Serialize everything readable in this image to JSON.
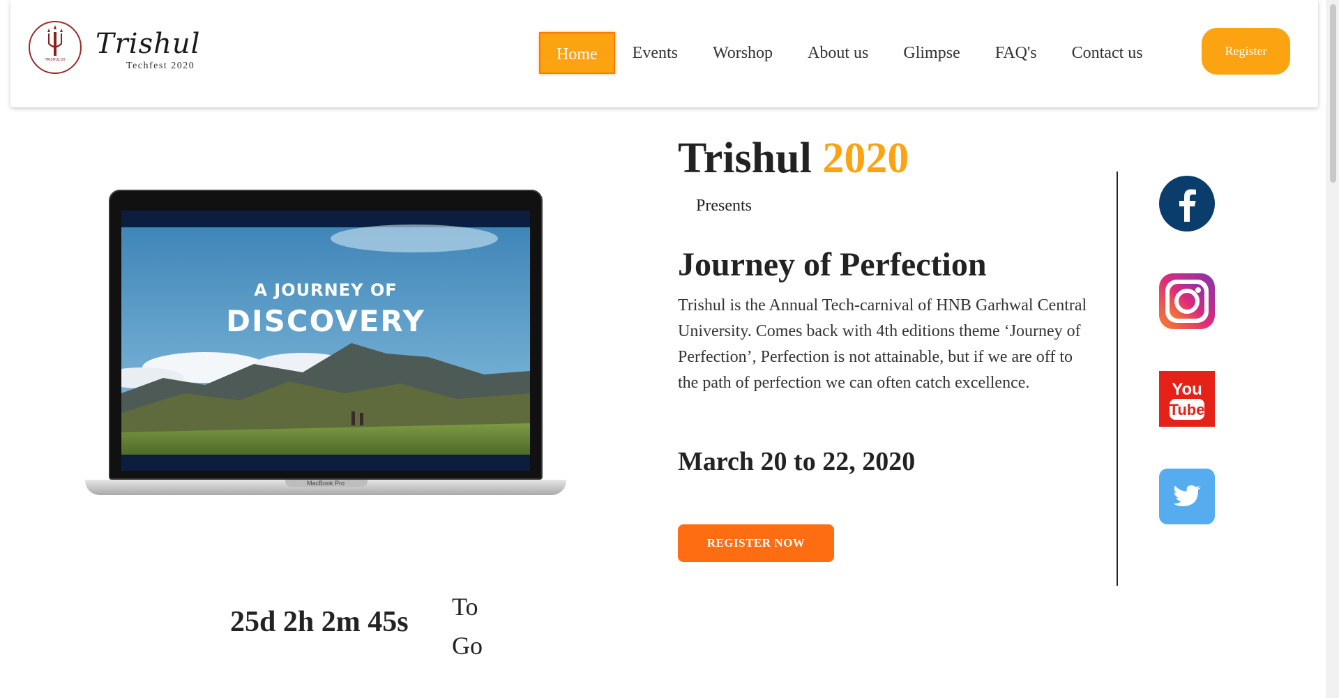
{
  "header": {
    "logo": {
      "title": "Trishul",
      "subtitle": "Techfest 2020",
      "badge_text": "TRISHUL'20"
    },
    "nav": [
      {
        "label": "Home",
        "active": true
      },
      {
        "label": "Events",
        "active": false
      },
      {
        "label": "Worshop",
        "active": false
      },
      {
        "label": "About us",
        "active": false
      },
      {
        "label": "Glimpse",
        "active": false
      },
      {
        "label": "FAQ's",
        "active": false
      },
      {
        "label": "Contact us",
        "active": false
      }
    ],
    "register_label": "Register"
  },
  "hero": {
    "laptop": {
      "screen_line1": "A JOURNEY OF",
      "screen_line2": "DISCOVERY",
      "brand": "MacBook Pro"
    },
    "title_name": "Trishul",
    "title_year": "2020",
    "presents": "Presents",
    "theme": "Journey of Perfection",
    "description": "Trishul is the Annual Tech-carnival of HNB Garhwal Central University. Comes back with 4th editions theme ‘Journey of Perfection’, Perfection is not attainable, but if we are off to the path of perfection we can often catch excellence.",
    "dates": "March 20 to 22, 2020",
    "register_now_label": "REGISTER NOW"
  },
  "countdown": {
    "time": "25d 2h 2m 45s",
    "to_go_line1": "To",
    "to_go_line2": "Go"
  },
  "social": [
    {
      "name": "facebook",
      "icon": "facebook-icon",
      "color": "#0a3d6b"
    },
    {
      "name": "instagram",
      "icon": "instagram-icon",
      "color": "#c13584"
    },
    {
      "name": "youtube",
      "icon": "youtube-icon",
      "color": "#e62117"
    },
    {
      "name": "twitter",
      "icon": "twitter-icon",
      "color": "#55acee"
    }
  ],
  "colors": {
    "accent": "#fca311",
    "accent_border": "#ff7a00",
    "cta": "#ff6d12",
    "text": "#222222"
  }
}
